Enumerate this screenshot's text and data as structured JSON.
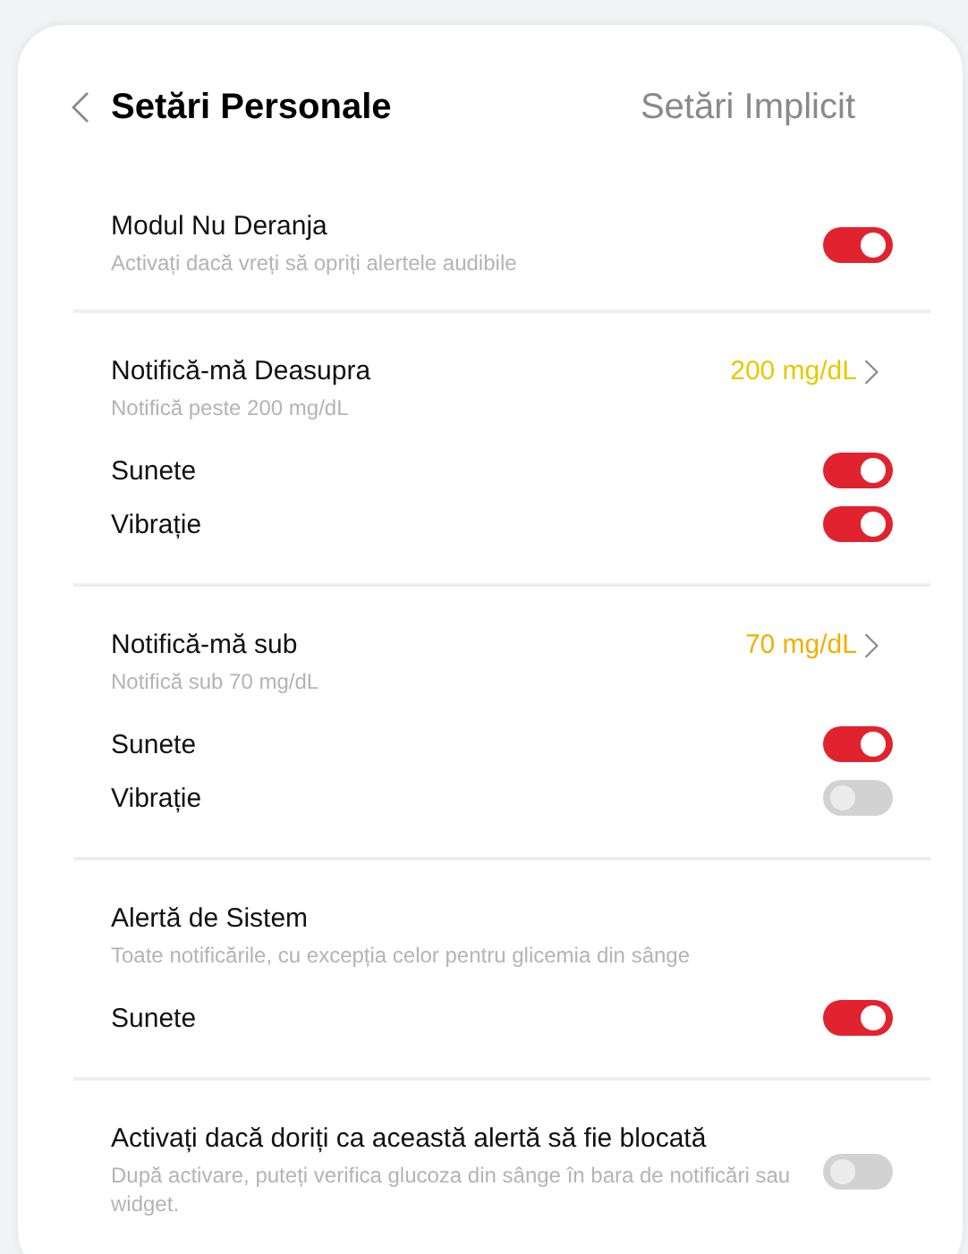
{
  "header": {
    "title": "Setări Personale",
    "action": "Setări Implicit"
  },
  "sections": [
    {
      "title": "Modul Nu Deranja",
      "subtitle": "Activați dacă vreți să opriți alertele audibile",
      "on": true
    },
    {
      "title": "Notifică-mă Deasupra",
      "subtitle": "Notifică peste 200 mg/dL",
      "value": {
        "text": "200 mg/dL",
        "color": "#e8c800"
      },
      "rows": [
        {
          "label": "Sunete",
          "on": true
        },
        {
          "label": "Vibrație",
          "on": true
        }
      ]
    },
    {
      "title": "Notifică-mă sub",
      "subtitle": "Notifică sub 70 mg/dL",
      "value": {
        "text": "70 mg/dL",
        "color": "#f0b000"
      },
      "rows": [
        {
          "label": "Sunete",
          "on": true
        },
        {
          "label": "Vibrație",
          "on": false
        }
      ]
    },
    {
      "title": "Alertă de Sistem",
      "subtitle": "Toate notificările, cu excepția celor pentru glicemia din sânge",
      "rows": [
        {
          "label": "Sunete",
          "on": true
        }
      ]
    },
    {
      "title": "Activați dacă doriți ca această alertă să fie blocată",
      "subtitle": "După activare, puteți verifica glucoza din sânge în bara de notificări sau widget.",
      "on": false
    }
  ]
}
